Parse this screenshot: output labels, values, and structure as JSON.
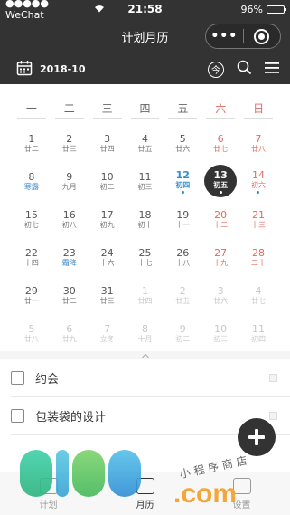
{
  "status_bar": {
    "carrier": "●●●●● WeChat",
    "time": "21:58",
    "battery": "96%",
    "battery_level": 0.96
  },
  "nav": {
    "title": "计划月历"
  },
  "toolbar": {
    "month": "2018-10",
    "today_label": "今"
  },
  "weekdays": [
    "一",
    "二",
    "三",
    "四",
    "五",
    "六",
    "日"
  ],
  "calendar_days": [
    {
      "day": "1",
      "lunar": "廿二",
      "type": "normal"
    },
    {
      "day": "2",
      "lunar": "廿三",
      "type": "normal"
    },
    {
      "day": "3",
      "lunar": "廿四",
      "type": "normal"
    },
    {
      "day": "4",
      "lunar": "廿五",
      "type": "normal"
    },
    {
      "day": "5",
      "lunar": "廿六",
      "type": "normal"
    },
    {
      "day": "6",
      "lunar": "廿七",
      "type": "weekend"
    },
    {
      "day": "7",
      "lunar": "廿八",
      "type": "weekend"
    },
    {
      "day": "8",
      "lunar": "寒露",
      "type": "term"
    },
    {
      "day": "9",
      "lunar": "九月",
      "type": "normal"
    },
    {
      "day": "10",
      "lunar": "初二",
      "type": "normal"
    },
    {
      "day": "11",
      "lunar": "初三",
      "type": "normal"
    },
    {
      "day": "12",
      "lunar": "初四",
      "type": "today",
      "mark": true
    },
    {
      "day": "13",
      "lunar": "初五",
      "type": "selected",
      "mark": true
    },
    {
      "day": "14",
      "lunar": "初六",
      "type": "weekend",
      "mark": true
    },
    {
      "day": "15",
      "lunar": "初七",
      "type": "normal"
    },
    {
      "day": "16",
      "lunar": "初八",
      "type": "normal"
    },
    {
      "day": "17",
      "lunar": "初九",
      "type": "normal"
    },
    {
      "day": "18",
      "lunar": "初十",
      "type": "normal"
    },
    {
      "day": "19",
      "lunar": "十一",
      "type": "normal"
    },
    {
      "day": "20",
      "lunar": "十二",
      "type": "weekend"
    },
    {
      "day": "21",
      "lunar": "十三",
      "type": "weekend"
    },
    {
      "day": "22",
      "lunar": "十四",
      "type": "normal"
    },
    {
      "day": "23",
      "lunar": "霜降",
      "type": "term"
    },
    {
      "day": "24",
      "lunar": "十六",
      "type": "normal"
    },
    {
      "day": "25",
      "lunar": "十七",
      "type": "normal"
    },
    {
      "day": "26",
      "lunar": "十八",
      "type": "normal"
    },
    {
      "day": "27",
      "lunar": "十九",
      "type": "weekend"
    },
    {
      "day": "28",
      "lunar": "二十",
      "type": "weekend"
    },
    {
      "day": "29",
      "lunar": "廿一",
      "type": "normal"
    },
    {
      "day": "30",
      "lunar": "廿二",
      "type": "normal"
    },
    {
      "day": "31",
      "lunar": "廿三",
      "type": "normal"
    },
    {
      "day": "1",
      "lunar": "廿四",
      "type": "other"
    },
    {
      "day": "2",
      "lunar": "廿五",
      "type": "other"
    },
    {
      "day": "3",
      "lunar": "廿六",
      "type": "other"
    },
    {
      "day": "4",
      "lunar": "廿七",
      "type": "other"
    },
    {
      "day": "5",
      "lunar": "廿八",
      "type": "other"
    },
    {
      "day": "6",
      "lunar": "廿九",
      "type": "other"
    },
    {
      "day": "7",
      "lunar": "立冬",
      "type": "other"
    },
    {
      "day": "8",
      "lunar": "十月",
      "type": "other"
    },
    {
      "day": "9",
      "lunar": "初二",
      "type": "other"
    },
    {
      "day": "10",
      "lunar": "初三",
      "type": "other"
    },
    {
      "day": "11",
      "lunar": "初四",
      "type": "other"
    }
  ],
  "todos": [
    {
      "text": "约会"
    },
    {
      "text": "包装袋的设计"
    }
  ],
  "tabbar": {
    "tabs": [
      {
        "label": "计划",
        "icon": "plan-icon",
        "active": false
      },
      {
        "label": "月历",
        "icon": "calendar-icon",
        "active": true
      },
      {
        "label": "设置",
        "icon": "settings-icon",
        "active": false
      }
    ]
  },
  "watermark": {
    "subtitle": "小程序商店",
    "domain": ".com"
  },
  "colors": {
    "header_bg": "#333333",
    "weekend": "#e36a5f",
    "today": "#2d8fd2",
    "solar_term": "#3b87c8"
  }
}
